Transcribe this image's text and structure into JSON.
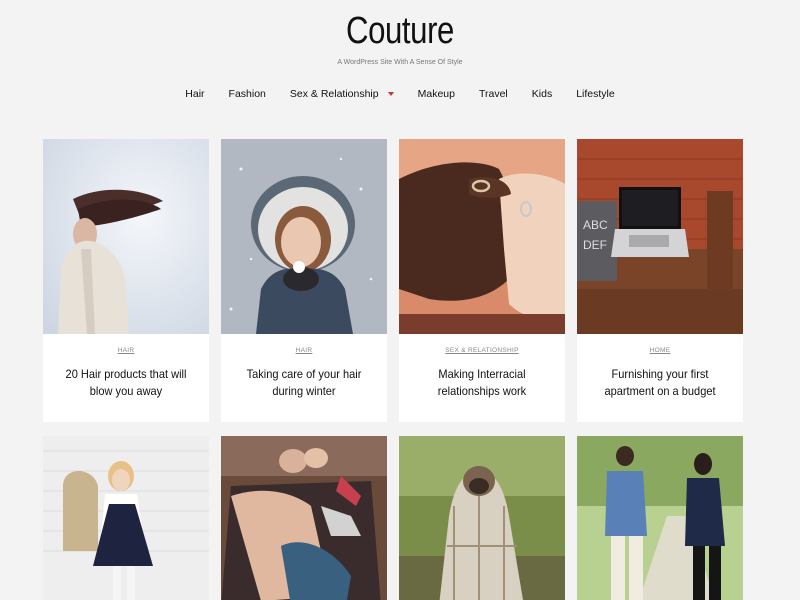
{
  "site": {
    "title": "Couture",
    "description": "A WordPress Site With A Sense Of Style"
  },
  "nav": {
    "items": [
      {
        "label": "Hair"
      },
      {
        "label": "Fashion"
      },
      {
        "label": "Sex & Relationship",
        "has_dropdown": true
      },
      {
        "label": "Makeup"
      },
      {
        "label": "Travel"
      },
      {
        "label": "Kids"
      },
      {
        "label": "Lifestyle"
      }
    ]
  },
  "posts": [
    {
      "category": "HAIR",
      "title": "20 Hair products that will blow you away",
      "image": "woman-hair-flying"
    },
    {
      "category": "HAIR",
      "title": "Taking care of your hair during winter",
      "image": "woman-in-snow"
    },
    {
      "category": "SEX & RELATIONSHIP",
      "title": "Making Interracial relationships work",
      "image": "holding-hands-rings"
    },
    {
      "category": "HOME",
      "title": "Furnishing your first apartment on a budget",
      "image": "laptop-on-sofa"
    },
    {
      "image": "girl-on-chair"
    },
    {
      "image": "couple-embracing"
    },
    {
      "image": "dog-in-blanket"
    },
    {
      "image": "couple-walking"
    }
  ],
  "colors": {
    "background": "#f3f3f3",
    "accent": "#c0392b"
  }
}
